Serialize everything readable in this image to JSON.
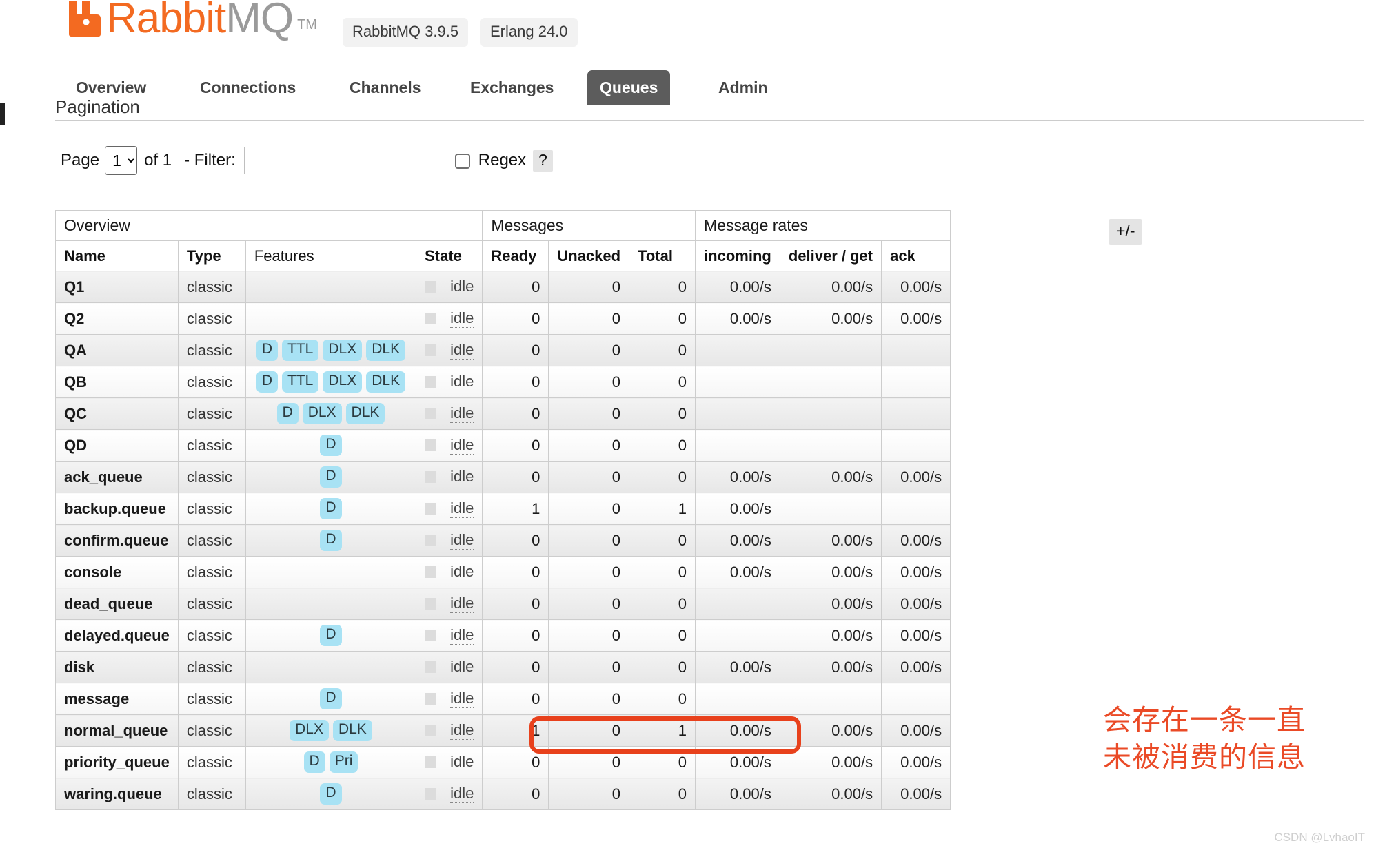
{
  "header": {
    "logo_text_primary": "Rabbit",
    "logo_text_secondary": "MQ",
    "trademark": "TM",
    "rabbit_version": "RabbitMQ 3.9.5",
    "erlang_version": "Erlang 24.0"
  },
  "nav": {
    "items": [
      {
        "label": "Overview",
        "active": false
      },
      {
        "label": "Connections",
        "active": false
      },
      {
        "label": "Channels",
        "active": false
      },
      {
        "label": "Exchanges",
        "active": false
      },
      {
        "label": "Queues",
        "active": true
      },
      {
        "label": "Admin",
        "active": false
      }
    ]
  },
  "pagination": {
    "section_title": "Pagination",
    "page_label": "Page",
    "page_value": "1",
    "page_options": [
      "1"
    ],
    "of_text": "of 1",
    "filter_label": "- Filter:",
    "filter_value": "",
    "filter_placeholder": "",
    "regex_label": "Regex",
    "help_label": "?"
  },
  "table": {
    "plus_minus_label": "+/-",
    "group_headers": [
      {
        "label": "Overview",
        "span": 4
      },
      {
        "label": "Messages",
        "span": 3
      },
      {
        "label": "Message rates",
        "span": 3
      }
    ],
    "columns": [
      {
        "label": "Name",
        "bold": true,
        "align": "left"
      },
      {
        "label": "Type",
        "bold": true,
        "align": "left"
      },
      {
        "label": "Features",
        "bold": false,
        "align": "left"
      },
      {
        "label": "State",
        "bold": true,
        "align": "left"
      },
      {
        "label": "Ready",
        "bold": true,
        "align": "right"
      },
      {
        "label": "Unacked",
        "bold": true,
        "align": "right"
      },
      {
        "label": "Total",
        "bold": true,
        "align": "right"
      },
      {
        "label": "incoming",
        "bold": true,
        "align": "right"
      },
      {
        "label": "deliver / get",
        "bold": true,
        "align": "right"
      },
      {
        "label": "ack",
        "bold": true,
        "align": "right"
      }
    ],
    "rows": [
      {
        "name": "Q1",
        "type": "classic",
        "features": [],
        "state": "idle",
        "ready": "0",
        "unacked": "0",
        "total": "0",
        "incoming": "0.00/s",
        "deliver_get": "0.00/s",
        "ack": "0.00/s"
      },
      {
        "name": "Q2",
        "type": "classic",
        "features": [],
        "state": "idle",
        "ready": "0",
        "unacked": "0",
        "total": "0",
        "incoming": "0.00/s",
        "deliver_get": "0.00/s",
        "ack": "0.00/s"
      },
      {
        "name": "QA",
        "type": "classic",
        "features": [
          "D",
          "TTL",
          "DLX",
          "DLK"
        ],
        "state": "idle",
        "ready": "0",
        "unacked": "0",
        "total": "0",
        "incoming": "",
        "deliver_get": "",
        "ack": ""
      },
      {
        "name": "QB",
        "type": "classic",
        "features": [
          "D",
          "TTL",
          "DLX",
          "DLK"
        ],
        "state": "idle",
        "ready": "0",
        "unacked": "0",
        "total": "0",
        "incoming": "",
        "deliver_get": "",
        "ack": ""
      },
      {
        "name": "QC",
        "type": "classic",
        "features": [
          "D",
          "DLX",
          "DLK"
        ],
        "state": "idle",
        "ready": "0",
        "unacked": "0",
        "total": "0",
        "incoming": "",
        "deliver_get": "",
        "ack": ""
      },
      {
        "name": "QD",
        "type": "classic",
        "features": [
          "D"
        ],
        "state": "idle",
        "ready": "0",
        "unacked": "0",
        "total": "0",
        "incoming": "",
        "deliver_get": "",
        "ack": ""
      },
      {
        "name": "ack_queue",
        "type": "classic",
        "features": [
          "D"
        ],
        "state": "idle",
        "ready": "0",
        "unacked": "0",
        "total": "0",
        "incoming": "0.00/s",
        "deliver_get": "0.00/s",
        "ack": "0.00/s"
      },
      {
        "name": "backup.queue",
        "type": "classic",
        "features": [
          "D"
        ],
        "state": "idle",
        "ready": "1",
        "unacked": "0",
        "total": "1",
        "incoming": "0.00/s",
        "deliver_get": "",
        "ack": ""
      },
      {
        "name": "confirm.queue",
        "type": "classic",
        "features": [
          "D"
        ],
        "state": "idle",
        "ready": "0",
        "unacked": "0",
        "total": "0",
        "incoming": "0.00/s",
        "deliver_get": "0.00/s",
        "ack": "0.00/s"
      },
      {
        "name": "console",
        "type": "classic",
        "features": [],
        "state": "idle",
        "ready": "0",
        "unacked": "0",
        "total": "0",
        "incoming": "0.00/s",
        "deliver_get": "0.00/s",
        "ack": "0.00/s"
      },
      {
        "name": "dead_queue",
        "type": "classic",
        "features": [],
        "state": "idle",
        "ready": "0",
        "unacked": "0",
        "total": "0",
        "incoming": "",
        "deliver_get": "0.00/s",
        "ack": "0.00/s"
      },
      {
        "name": "delayed.queue",
        "type": "classic",
        "features": [
          "D"
        ],
        "state": "idle",
        "ready": "0",
        "unacked": "0",
        "total": "0",
        "incoming": "",
        "deliver_get": "0.00/s",
        "ack": "0.00/s"
      },
      {
        "name": "disk",
        "type": "classic",
        "features": [],
        "state": "idle",
        "ready": "0",
        "unacked": "0",
        "total": "0",
        "incoming": "0.00/s",
        "deliver_get": "0.00/s",
        "ack": "0.00/s"
      },
      {
        "name": "message",
        "type": "classic",
        "features": [
          "D"
        ],
        "state": "idle",
        "ready": "0",
        "unacked": "0",
        "total": "0",
        "incoming": "",
        "deliver_get": "",
        "ack": ""
      },
      {
        "name": "normal_queue",
        "type": "classic",
        "features": [
          "DLX",
          "DLK"
        ],
        "state": "idle",
        "ready": "1",
        "unacked": "0",
        "total": "1",
        "incoming": "0.00/s",
        "deliver_get": "0.00/s",
        "ack": "0.00/s"
      },
      {
        "name": "priority_queue",
        "type": "classic",
        "features": [
          "D",
          "Pri"
        ],
        "state": "idle",
        "ready": "0",
        "unacked": "0",
        "total": "0",
        "incoming": "0.00/s",
        "deliver_get": "0.00/s",
        "ack": "0.00/s"
      },
      {
        "name": "waring.queue",
        "type": "classic",
        "features": [
          "D"
        ],
        "state": "idle",
        "ready": "0",
        "unacked": "0",
        "total": "0",
        "incoming": "0.00/s",
        "deliver_get": "0.00/s",
        "ack": "0.00/s"
      }
    ]
  },
  "annotations": {
    "highlight_color": "#e8411c",
    "note_text": "会存在一条一直\n未被消费的信息",
    "note_color": "#ea4a26",
    "watermark": "CSDN @LvhaoIT"
  }
}
